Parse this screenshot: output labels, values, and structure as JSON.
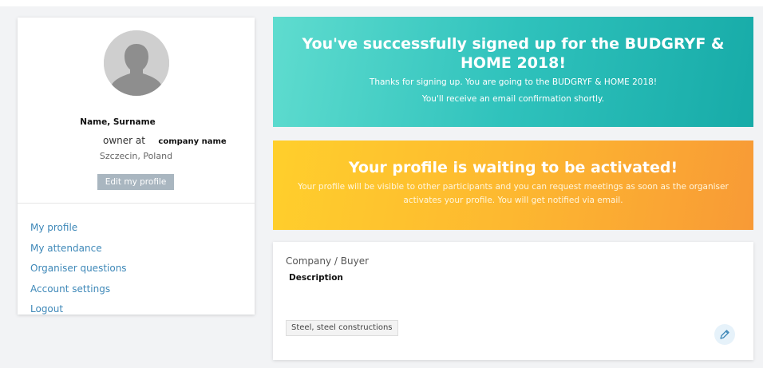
{
  "profile": {
    "name": "Name, Surname",
    "role": "owner at",
    "company": "company name",
    "location": "Szczecin, Poland",
    "edit_label": "Edit my profile"
  },
  "nav": {
    "items": [
      "My profile",
      "My attendance",
      "Organiser questions",
      "Account settings",
      "Logout"
    ]
  },
  "success_banner": {
    "title": "You've successfully signed up for the BUDGRYF & HOME 2018!",
    "line1": "Thanks for signing up. You are going to the BUDGRYF & HOME 2018!",
    "line2": "You'll receive an email confirmation shortly."
  },
  "pending_banner": {
    "title": "Your profile is waiting to be activated!",
    "text": "Your profile will be visible to other participants and you can request meetings as soon as the organiser activates your profile. You will get notified via email."
  },
  "company_card": {
    "type": "Company / Buyer",
    "description": "Description",
    "tags": [
      "Steel, steel constructions"
    ]
  },
  "icons": {
    "avatar": "user-silhouette-icon",
    "edit": "pencil-icon"
  },
  "colors": {
    "success": "#2fc2bc",
    "pending": "#fdb830",
    "link": "#3e88b8",
    "button": "#a9b6c0"
  }
}
